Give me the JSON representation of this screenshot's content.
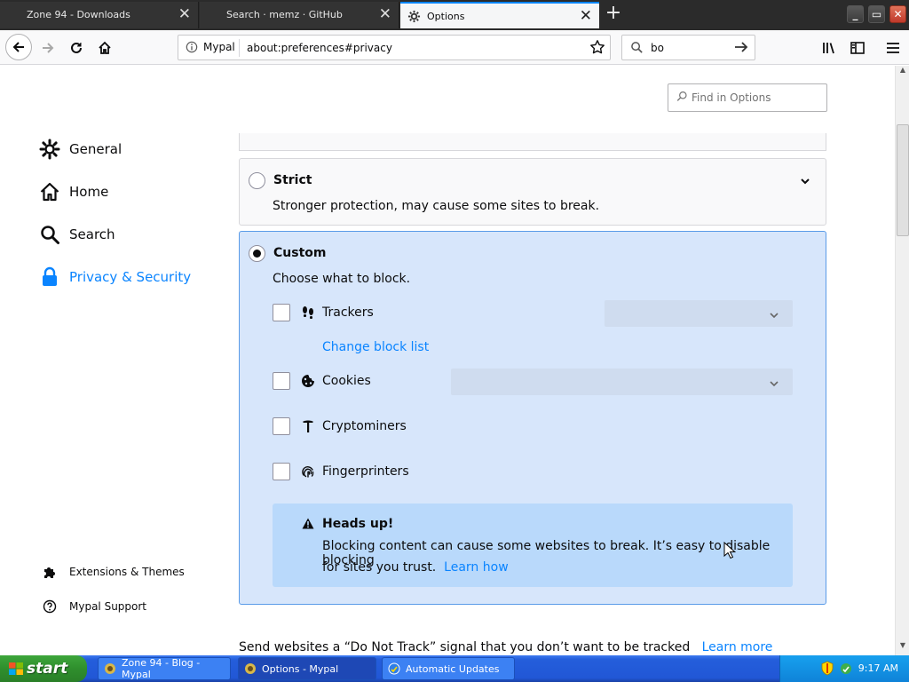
{
  "tabs": [
    {
      "title": "Zone 94 - Downloads",
      "close": "✕"
    },
    {
      "title": "Search · memz · GitHub",
      "close": "✕"
    },
    {
      "title": "Options",
      "close": "✕"
    }
  ],
  "window_controls": {
    "minimize": "_",
    "restore": "▭",
    "close": "✕"
  },
  "urlbar": {
    "identity": "Mypal",
    "url": "about:preferences#privacy"
  },
  "searchbar": {
    "value": "bo"
  },
  "find_in_options": {
    "placeholder": "Find in Options"
  },
  "categories": [
    {
      "label": "General"
    },
    {
      "label": "Home"
    },
    {
      "label": "Search"
    },
    {
      "label": "Privacy & Security"
    }
  ],
  "bottom_links": {
    "extensions": "Extensions & Themes",
    "support": "Mypal Support"
  },
  "strict": {
    "title": "Strict",
    "description": "Stronger protection, may cause some sites to break."
  },
  "custom": {
    "title": "Custom",
    "description": "Choose what to block.",
    "options": [
      {
        "label": "Trackers"
      },
      {
        "label": "Cookies"
      },
      {
        "label": "Cryptominers"
      },
      {
        "label": "Fingerprinters"
      }
    ],
    "change_block_list": "Change block list"
  },
  "headsup": {
    "title": "Heads up!",
    "line1": "Blocking content can cause some websites to break. It’s easy to disable blocking",
    "line2": "for sites you trust.",
    "learn_how": "Learn how"
  },
  "dnt": {
    "text": "Send websites a “Do Not Track” signal that you don’t want to be tracked",
    "learn_more": "Learn more"
  },
  "taskbar": {
    "start": "start",
    "tasks": [
      {
        "label": "Zone 94 - Blog - Mypal"
      },
      {
        "label": "Options - Mypal"
      },
      {
        "label": "Automatic Updates"
      }
    ],
    "clock": "9:17 AM"
  },
  "colors": {
    "accent": "#0a84ff",
    "custom_bg": "#d7e6fb",
    "headsup_bg": "#b9d9fb",
    "taskbar": "#245edb"
  }
}
